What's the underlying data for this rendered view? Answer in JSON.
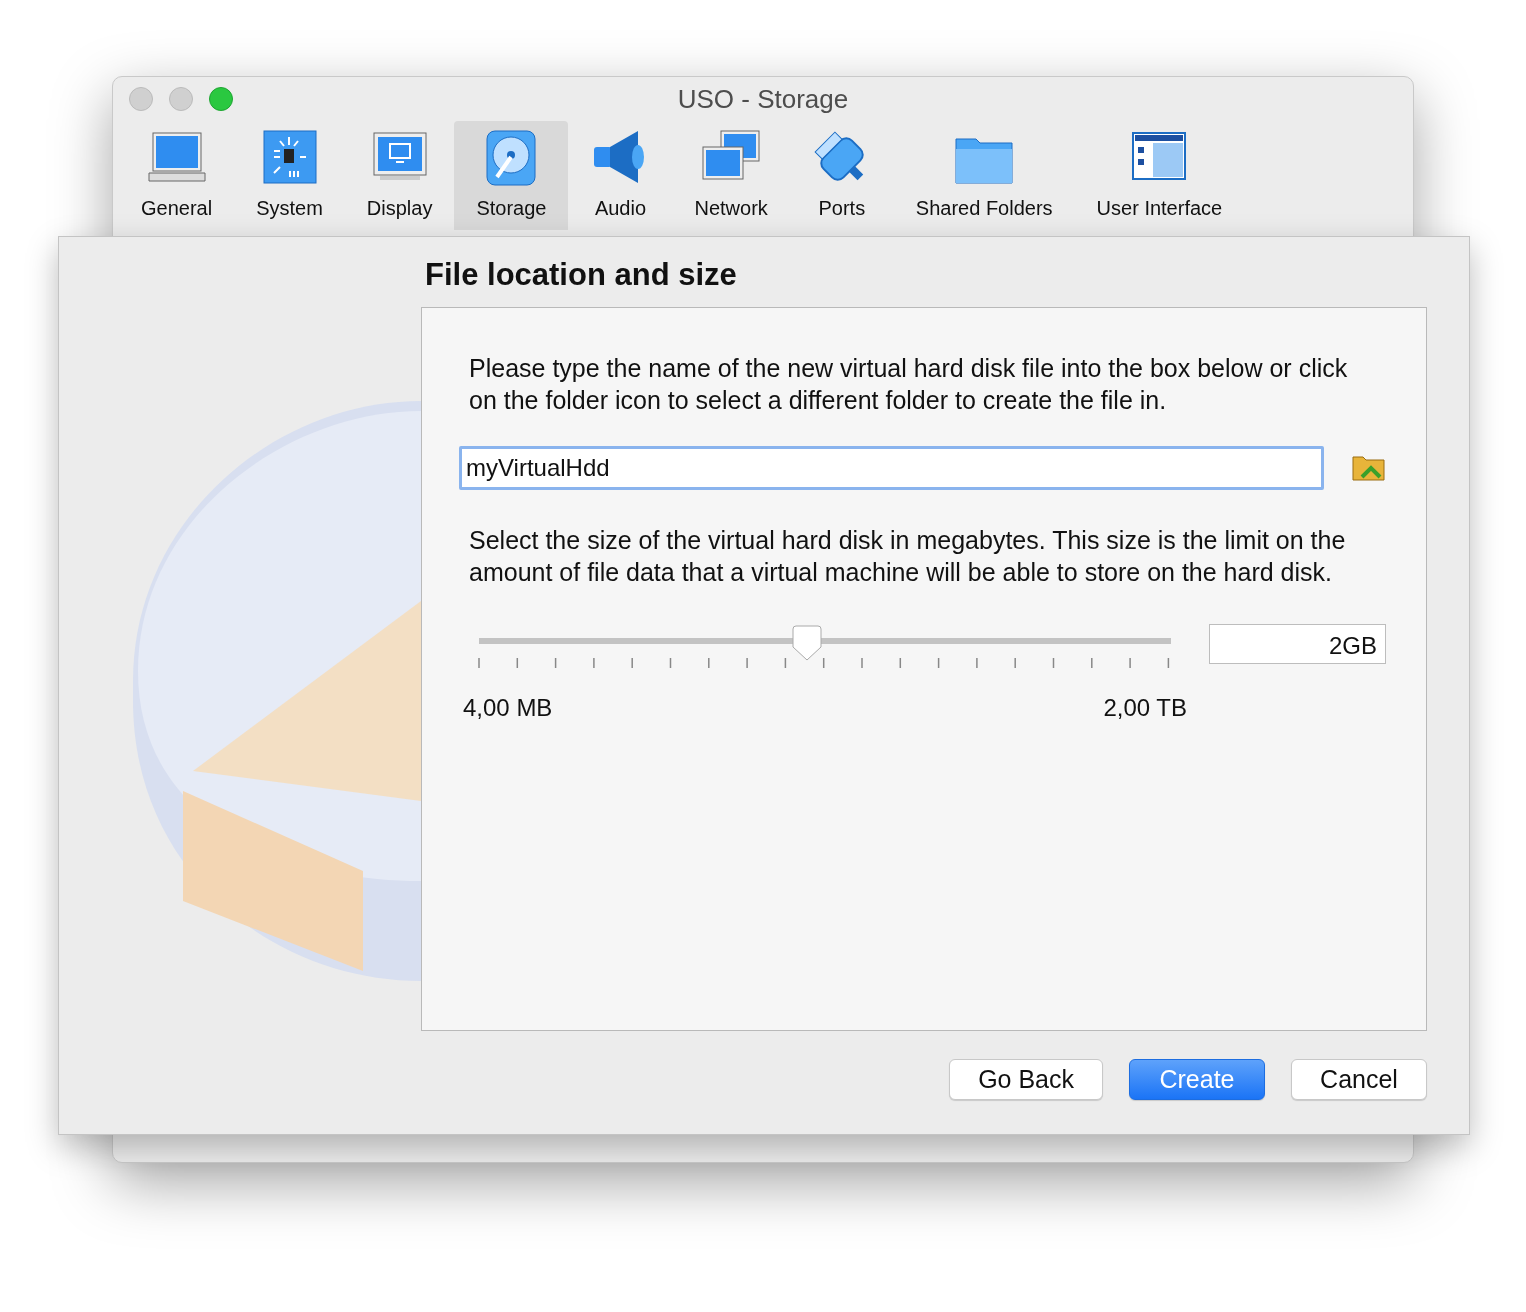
{
  "window": {
    "title": "USO - Storage"
  },
  "toolbar": [
    {
      "label": "General",
      "selected": false
    },
    {
      "label": "System",
      "selected": false
    },
    {
      "label": "Display",
      "selected": false
    },
    {
      "label": "Storage",
      "selected": true
    },
    {
      "label": "Audio",
      "selected": false
    },
    {
      "label": "Network",
      "selected": false
    },
    {
      "label": "Ports",
      "selected": false
    },
    {
      "label": "Shared Folders",
      "selected": false
    },
    {
      "label": "User Interface",
      "selected": false
    }
  ],
  "sheet": {
    "heading": "File location and size",
    "intro": "Please type the name of the new virtual hard disk file into the box below or click on the folder icon to select a different folder to create the file in.",
    "file_name": {
      "value": "myVirtualHdd"
    },
    "size_text": "Select the size of the virtual hard disk in megabytes. This size is the limit on the amount of file data that a virtual machine will be able to store on the hard disk.",
    "size_slider": {
      "level": 0.474,
      "min_label": "4,00 MB",
      "max_label": "2,00 TB"
    },
    "size_field": {
      "value": "2GB"
    },
    "buttons": [
      {
        "label": "Go Back",
        "default": false
      },
      {
        "label": "Create",
        "default": true
      },
      {
        "label": "Cancel",
        "default": false
      }
    ]
  }
}
